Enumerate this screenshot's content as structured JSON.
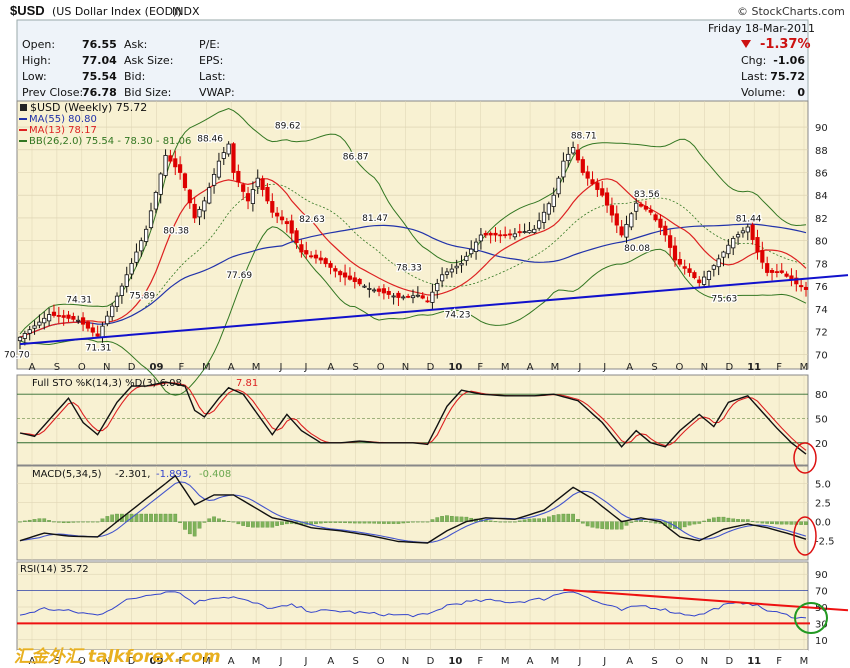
{
  "header": {
    "symbol": "$USD",
    "name": "(US Dollar Index (EOD))",
    "exchange": "INDX",
    "copyright": "© StockCharts.com"
  },
  "quote": {
    "day": "Friday",
    "date": "18-Mar-2011",
    "pct_change": "-1.37%",
    "left": [
      {
        "label": "Open:",
        "value": "76.55"
      },
      {
        "label": "High:",
        "value": "77.04"
      },
      {
        "label": "Low:",
        "value": "75.54"
      },
      {
        "label": "Prev Close:",
        "value": "76.78"
      }
    ],
    "mid": [
      "Ask:",
      "Ask Size:",
      "Bid:",
      "Bid Size:"
    ],
    "pe": [
      "P/E:",
      "EPS:",
      "Last:",
      "VWAP:"
    ],
    "right": [
      {
        "label": "Chg:",
        "value": "-1.06"
      },
      {
        "label": "Last:",
        "value": "75.72"
      },
      {
        "label": "Volume:",
        "value": "0"
      }
    ]
  },
  "legend": {
    "main": "$USD (Weekly) 75.72",
    "ma55": "MA(55) 80.80",
    "ma13": "MA(13) 78.17",
    "bb": "BB(26,2.0) 75.54 - 78.30 - 81.06",
    "sto_name": "Full STO %K(14,3) %D(3) 6.08,",
    "sto_d": "7.81",
    "macd_name": "MACD(5,34,5)",
    "macd_v1": "-2.301,",
    "macd_v2": "-1.893,",
    "macd_v3": "-0.408",
    "rsi": "RSI(14) 35.72"
  },
  "watermark": "汇金外汇 talkforex.com",
  "colors": {
    "up": "#111111",
    "down": "#dd0000",
    "ma55": "#2233aa",
    "ma13": "#dd2222",
    "bb": "#337722",
    "trend": "#1111cc",
    "rsi_line": "#3344cc",
    "bg": "#f8f1d2"
  },
  "chart_data": [
    {
      "type": "candlestick",
      "panel": "price",
      "ylim": [
        69.5,
        91.5
      ],
      "y_ticks": [
        70,
        72,
        74,
        76,
        78,
        80,
        82,
        84,
        86,
        88,
        90
      ],
      "x_labels": [
        "A",
        "S",
        "O",
        "N",
        "D",
        "09",
        "F",
        "M",
        "A",
        "M",
        "J",
        "J",
        "A",
        "S",
        "O",
        "N",
        "D",
        "10",
        "F",
        "M",
        "A",
        "M",
        "J",
        "J",
        "A",
        "S",
        "O",
        "N",
        "D",
        "11",
        "F",
        "M"
      ],
      "closes_knots": [
        [
          0,
          71.5
        ],
        [
          6,
          73.5
        ],
        [
          12,
          73
        ],
        [
          16,
          71.6
        ],
        [
          21,
          76
        ],
        [
          26,
          81
        ],
        [
          30,
          87.5
        ],
        [
          33,
          86
        ],
        [
          36,
          82
        ],
        [
          38,
          83.5
        ],
        [
          41,
          87
        ],
        [
          43,
          88.5
        ],
        [
          44,
          86
        ],
        [
          47,
          83.5
        ],
        [
          49,
          85.5
        ],
        [
          52,
          82.5
        ],
        [
          55,
          81.5
        ],
        [
          58,
          79
        ],
        [
          62,
          78.3
        ],
        [
          66,
          77
        ],
        [
          72,
          75.8
        ],
        [
          78,
          75
        ],
        [
          82,
          75.2
        ],
        [
          84,
          74.7
        ],
        [
          87,
          77
        ],
        [
          91,
          78
        ],
        [
          95,
          80.5
        ],
        [
          101,
          80.5
        ],
        [
          106,
          81
        ],
        [
          110,
          84
        ],
        [
          112,
          87
        ],
        [
          114,
          88.2
        ],
        [
          116,
          86
        ],
        [
          120,
          84
        ],
        [
          124,
          80.5
        ],
        [
          127,
          83.3
        ],
        [
          130,
          82.5
        ],
        [
          133,
          80.5
        ],
        [
          135,
          78.3
        ],
        [
          138,
          77.2
        ],
        [
          140,
          76.3
        ],
        [
          143,
          77.8
        ],
        [
          147,
          80.2
        ],
        [
          150,
          81.2
        ],
        [
          152,
          79
        ],
        [
          154,
          77.2
        ],
        [
          157,
          77.2
        ],
        [
          160,
          76.2
        ],
        [
          162,
          75.7
        ]
      ],
      "annotations": [
        {
          "label": "70.70",
          "value": 70.7
        },
        {
          "label": "71.31",
          "value": 71.31
        },
        {
          "label": "74.31",
          "value": 74.31
        },
        {
          "label": "75.89",
          "value": 75.89
        },
        {
          "label": "80.38",
          "value": 80.38
        },
        {
          "label": "88.46",
          "value": 88.46
        },
        {
          "label": "77.69",
          "value": 77.69
        },
        {
          "label": "89.62",
          "value": 89.62
        },
        {
          "label": "82.63",
          "value": 82.63
        },
        {
          "label": "86.87",
          "value": 86.87
        },
        {
          "label": "81.47",
          "value": 81.47
        },
        {
          "label": "78.33",
          "value": 78.33
        },
        {
          "label": "74.23",
          "value": 74.23
        },
        {
          "label": "88.71",
          "value": 88.71
        },
        {
          "label": "83.56",
          "value": 83.56
        },
        {
          "label": "80.08",
          "value": 80.08
        },
        {
          "label": "75.63",
          "value": 75.63
        },
        {
          "label": "81.44",
          "value": 81.44
        }
      ],
      "trendline": [
        [
          0,
          70.9
        ],
        [
          166,
          76.8
        ]
      ]
    },
    {
      "type": "line",
      "panel": "stochastics",
      "ylim": [
        -5,
        100
      ],
      "y_ticks": [
        20,
        50,
        80
      ],
      "k_knots": [
        [
          0,
          32
        ],
        [
          3,
          28
        ],
        [
          7,
          55
        ],
        [
          10,
          75
        ],
        [
          13,
          45
        ],
        [
          16,
          30
        ],
        [
          20,
          70
        ],
        [
          23,
          90
        ],
        [
          26,
          90
        ],
        [
          30,
          95
        ],
        [
          34,
          90
        ],
        [
          36,
          60
        ],
        [
          38,
          52
        ],
        [
          41,
          75
        ],
        [
          43,
          88
        ],
        [
          46,
          80
        ],
        [
          49,
          55
        ],
        [
          52,
          30
        ],
        [
          55,
          55
        ],
        [
          58,
          35
        ],
        [
          62,
          20
        ],
        [
          66,
          20
        ],
        [
          70,
          22
        ],
        [
          74,
          20
        ],
        [
          78,
          20
        ],
        [
          81,
          20
        ],
        [
          84,
          18
        ],
        [
          88,
          65
        ],
        [
          91,
          85
        ],
        [
          95,
          80
        ],
        [
          100,
          78
        ],
        [
          106,
          78
        ],
        [
          110,
          80
        ],
        [
          115,
          72
        ],
        [
          120,
          45
        ],
        [
          124,
          15
        ],
        [
          127,
          35
        ],
        [
          130,
          20
        ],
        [
          133,
          15
        ],
        [
          136,
          35
        ],
        [
          140,
          55
        ],
        [
          143,
          40
        ],
        [
          146,
          70
        ],
        [
          150,
          78
        ],
        [
          153,
          58
        ],
        [
          156,
          38
        ],
        [
          159,
          20
        ],
        [
          162,
          6
        ]
      ],
      "k_last": 6.08,
      "d_last": 7.81
    },
    {
      "type": "line",
      "panel": "macd",
      "ylim": [
        -4.5,
        6.5
      ],
      "y_ticks": [
        -2.5,
        0.0,
        2.5,
        5.0
      ],
      "macd_knots": [
        [
          0,
          -2.5
        ],
        [
          5,
          -1.5
        ],
        [
          10,
          -1.9
        ],
        [
          16,
          -2.0
        ],
        [
          22,
          1.0
        ],
        [
          27,
          3.5
        ],
        [
          32,
          6.0
        ],
        [
          36,
          2.2
        ],
        [
          40,
          3.5
        ],
        [
          44,
          3.5
        ],
        [
          48,
          2.0
        ],
        [
          52,
          0.5
        ],
        [
          56,
          0
        ],
        [
          60,
          -0.8
        ],
        [
          66,
          -1.2
        ],
        [
          72,
          -1.8
        ],
        [
          78,
          -2.6
        ],
        [
          84,
          -2.8
        ],
        [
          88,
          -1.2
        ],
        [
          92,
          0
        ],
        [
          96,
          0.5
        ],
        [
          102,
          0.3
        ],
        [
          108,
          1.5
        ],
        [
          112,
          3.5
        ],
        [
          114,
          4.5
        ],
        [
          118,
          3.0
        ],
        [
          124,
          0.0
        ],
        [
          128,
          0.5
        ],
        [
          132,
          0
        ],
        [
          136,
          -2.0
        ],
        [
          140,
          -2.5
        ],
        [
          145,
          -1.0
        ],
        [
          150,
          -0.3
        ],
        [
          154,
          -0.8
        ],
        [
          158,
          -1.5
        ],
        [
          162,
          -2.3
        ]
      ],
      "macd_last": -2.301,
      "signal_last": -1.893,
      "histogram_last": -0.408
    },
    {
      "type": "line",
      "panel": "rsi",
      "ylim": [
        0,
        100
      ],
      "y_ticks": [
        10,
        30,
        50,
        70,
        90
      ],
      "rsi_knots": [
        [
          0,
          40
        ],
        [
          5,
          48
        ],
        [
          10,
          45
        ],
        [
          16,
          40
        ],
        [
          22,
          58
        ],
        [
          27,
          66
        ],
        [
          32,
          70
        ],
        [
          36,
          55
        ],
        [
          40,
          62
        ],
        [
          44,
          62
        ],
        [
          48,
          55
        ],
        [
          52,
          48
        ],
        [
          56,
          52
        ],
        [
          60,
          45
        ],
        [
          66,
          45
        ],
        [
          72,
          42
        ],
        [
          78,
          40
        ],
        [
          84,
          40
        ],
        [
          88,
          52
        ],
        [
          92,
          56
        ],
        [
          96,
          58
        ],
        [
          102,
          56
        ],
        [
          108,
          60
        ],
        [
          112,
          68
        ],
        [
          114,
          70
        ],
        [
          118,
          58
        ],
        [
          124,
          46
        ],
        [
          128,
          52
        ],
        [
          132,
          48
        ],
        [
          136,
          42
        ],
        [
          140,
          40
        ],
        [
          145,
          52
        ],
        [
          150,
          56
        ],
        [
          154,
          46
        ],
        [
          158,
          40
        ],
        [
          162,
          35.72
        ]
      ],
      "rsi_last": 35.72
    }
  ]
}
